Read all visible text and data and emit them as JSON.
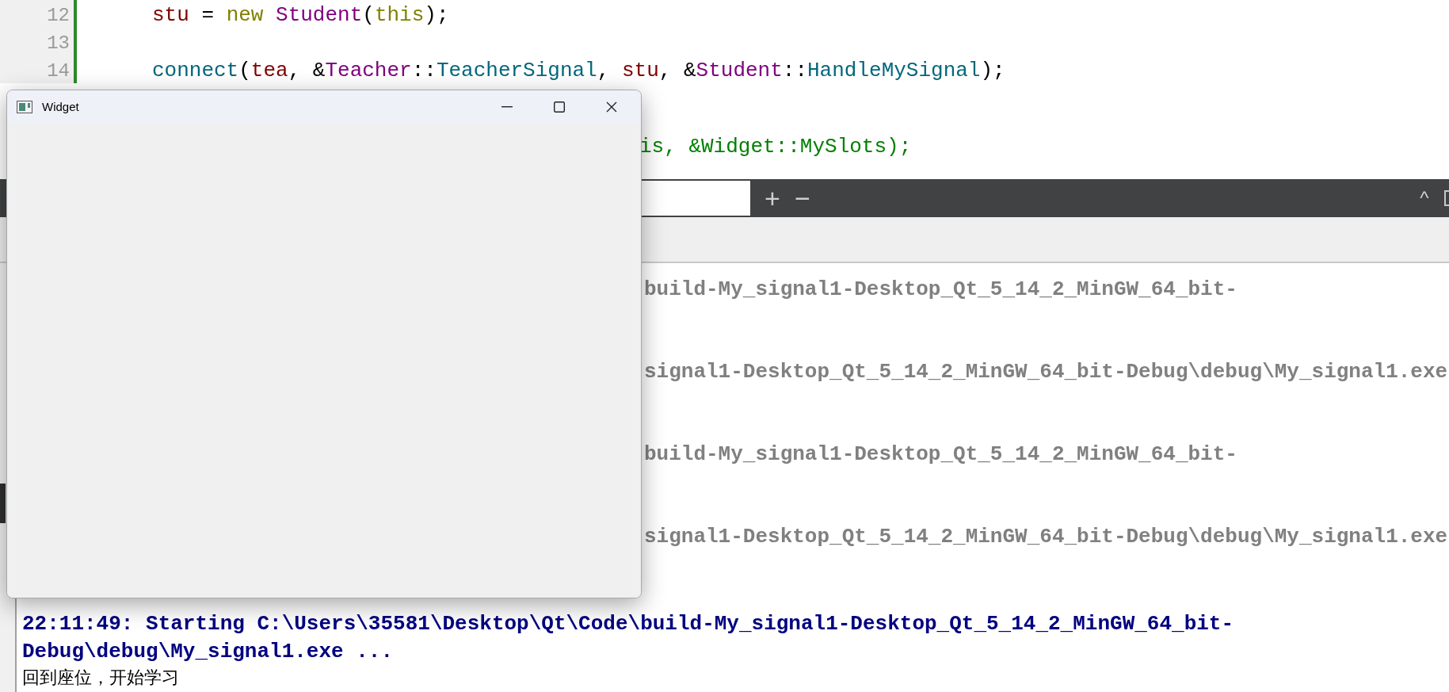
{
  "editor": {
    "lines": [
      {
        "number": "12",
        "tokens": [
          {
            "text": "stu",
            "kind": "variable"
          },
          {
            "text": " = ",
            "kind": "plain"
          },
          {
            "text": "new ",
            "kind": "keyword"
          },
          {
            "text": "Student",
            "kind": "type"
          },
          {
            "text": "(",
            "kind": "plain"
          },
          {
            "text": "this",
            "kind": "keyword"
          },
          {
            "text": ");",
            "kind": "plain"
          }
        ]
      },
      {
        "number": "13"
      },
      {
        "number": "14",
        "tokens": [
          {
            "text": "connect",
            "kind": "function"
          },
          {
            "text": "(",
            "kind": "plain"
          },
          {
            "text": "tea",
            "kind": "variable"
          },
          {
            "text": ", &",
            "kind": "plain"
          },
          {
            "text": "Teacher",
            "kind": "type"
          },
          {
            "text": "::",
            "kind": "plain"
          },
          {
            "text": "TeacherSignal",
            "kind": "function"
          },
          {
            "text": ", ",
            "kind": "plain"
          },
          {
            "text": "stu",
            "kind": "variable"
          },
          {
            "text": ", &",
            "kind": "plain"
          },
          {
            "text": "Student",
            "kind": "type"
          },
          {
            "text": "::",
            "kind": "plain"
          },
          {
            "text": "HandleMySignal",
            "kind": "function"
          },
          {
            "text": ");",
            "kind": "plain"
          }
        ]
      },
      {
        "tokens": [
          {
            "text": "is, &Widget::MySlots);",
            "kind": "string"
          }
        ]
      }
    ]
  },
  "output_toolbar": {
    "buttons": [
      "+",
      "−"
    ],
    "collapse": "^"
  },
  "output": {
    "lines": [
      {
        "text": "build-My_signal1-Desktop_Qt_5_14_2_MinGW_64_bit-",
        "kind": "previous"
      },
      {
        "text": "signal1-Desktop_Qt_5_14_2_MinGW_64_bit-Debug\\debug\\My_signal1.exe",
        "kind": "previous"
      },
      {
        "text": "build-My_signal1-Desktop_Qt_5_14_2_MinGW_64_bit-",
        "kind": "previous"
      },
      {
        "text": "signal1-Desktop_Qt_5_14_2_MinGW_64_bit-Debug\\debug\\My_signal1.exe",
        "kind": "previous"
      },
      {
        "text": "22:11:49: Starting C:\\Users\\35581\\Desktop\\Qt\\Code\\build-My_signal1-Desktop_Qt_5_14_2_MinGW_64_bit-",
        "kind": "status"
      },
      {
        "text": "Debug\\debug\\My_signal1.exe ...",
        "kind": "status"
      },
      {
        "text": "回到座位，开始学习",
        "kind": "program"
      }
    ]
  },
  "widget_window": {
    "title": "Widget"
  }
}
